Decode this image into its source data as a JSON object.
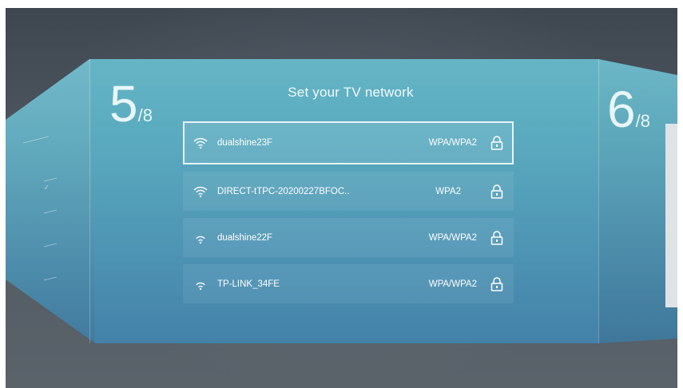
{
  "left_step": {
    "current": "5",
    "total": "/8"
  },
  "right_step": {
    "current": "6",
    "total": "/8"
  },
  "title": "Set your TV network",
  "networks": [
    {
      "ssid": "dualshine23F",
      "security": "WPA/WPA2",
      "selected": true
    },
    {
      "ssid": "DIRECT-tTPC-20200227BFOC..",
      "security": "WPA2",
      "selected": false
    },
    {
      "ssid": "dualshine22F",
      "security": "WPA/WPA2",
      "selected": false
    },
    {
      "ssid": "TP-LINK_34FE",
      "security": "WPA/WPA2",
      "selected": false
    }
  ],
  "icons": {
    "network": "wifi-icon",
    "security": "lock-icon"
  },
  "colors": {
    "panel_top": "#6cbccb",
    "panel_bottom": "#3f79a4",
    "background": "#3e4650"
  }
}
